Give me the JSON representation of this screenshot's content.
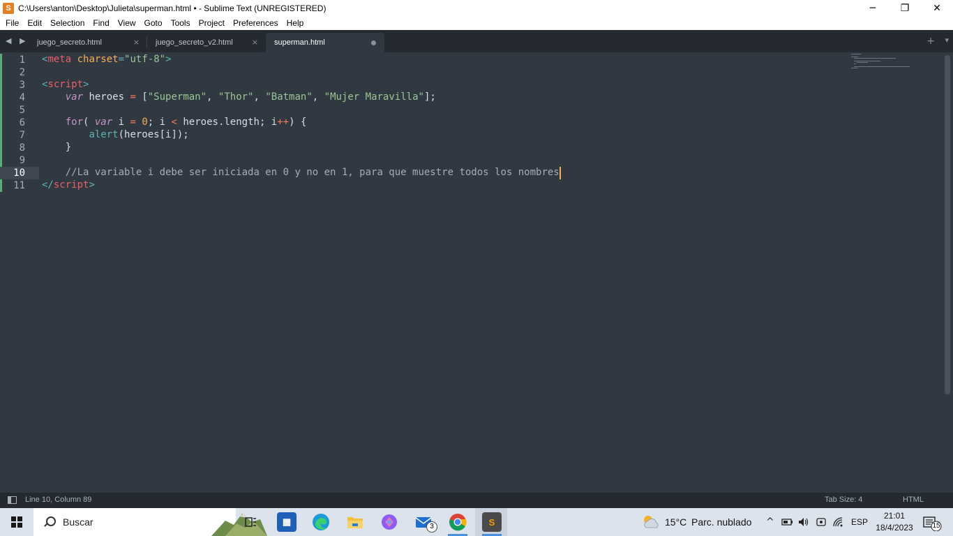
{
  "window": {
    "title": "C:\\Users\\anton\\Desktop\\Julieta\\superman.html • - Sublime Text (UNREGISTERED)",
    "minimize": "─",
    "maximize": "❐",
    "close": "✕"
  },
  "menu": [
    "File",
    "Edit",
    "Selection",
    "Find",
    "View",
    "Goto",
    "Tools",
    "Project",
    "Preferences",
    "Help"
  ],
  "tabs": [
    {
      "label": "juego_secreto.html",
      "active": false,
      "close": "×"
    },
    {
      "label": "juego_secreto_v2.html",
      "active": false,
      "close": "×"
    },
    {
      "label": "superman.html",
      "active": true,
      "modified": true
    }
  ],
  "tabbar": {
    "nav": "◀ ▶",
    "plus": "+",
    "chevron": "▾"
  },
  "editor": {
    "current_line": 10,
    "line_numbers": [
      "1",
      "2",
      "3",
      "4",
      "5",
      "6",
      "7",
      "8",
      "9",
      "10",
      "11"
    ],
    "lines": [
      [
        {
          "t": "<",
          "c": "punc"
        },
        {
          "t": "meta",
          "c": "tag"
        },
        {
          "t": " ",
          "c": ""
        },
        {
          "t": "charset",
          "c": "attr"
        },
        {
          "t": "=",
          "c": "punc"
        },
        {
          "t": "\"utf-8\"",
          "c": "str"
        },
        {
          "t": ">",
          "c": "punc"
        }
      ],
      [],
      [
        {
          "t": "<",
          "c": "punc"
        },
        {
          "t": "script",
          "c": "tag"
        },
        {
          "t": ">",
          "c": "punc"
        }
      ],
      [
        {
          "t": "    ",
          "c": ""
        },
        {
          "t": "var",
          "c": "kw-it"
        },
        {
          "t": " heroes ",
          "c": ""
        },
        {
          "t": "=",
          "c": "op"
        },
        {
          "t": " [",
          "c": ""
        },
        {
          "t": "\"Superman\"",
          "c": "str"
        },
        {
          "t": ", ",
          "c": ""
        },
        {
          "t": "\"Thor\"",
          "c": "str"
        },
        {
          "t": ", ",
          "c": ""
        },
        {
          "t": "\"Batman\"",
          "c": "str"
        },
        {
          "t": ", ",
          "c": ""
        },
        {
          "t": "\"Mujer Maravilla\"",
          "c": "str"
        },
        {
          "t": "];",
          "c": ""
        }
      ],
      [],
      [
        {
          "t": "    ",
          "c": ""
        },
        {
          "t": "for",
          "c": "kw"
        },
        {
          "t": "( ",
          "c": ""
        },
        {
          "t": "var",
          "c": "kw-it"
        },
        {
          "t": " i ",
          "c": ""
        },
        {
          "t": "=",
          "c": "op"
        },
        {
          "t": " ",
          "c": ""
        },
        {
          "t": "0",
          "c": "num"
        },
        {
          "t": "; i ",
          "c": ""
        },
        {
          "t": "<",
          "c": "op"
        },
        {
          "t": " heroes.length; i",
          "c": ""
        },
        {
          "t": "++",
          "c": "op"
        },
        {
          "t": ") {",
          "c": ""
        }
      ],
      [
        {
          "t": "        ",
          "c": ""
        },
        {
          "t": "alert",
          "c": "fn"
        },
        {
          "t": "(heroes[i]);",
          "c": ""
        }
      ],
      [
        {
          "t": "    }",
          "c": ""
        }
      ],
      [],
      [
        {
          "t": "    ",
          "c": ""
        },
        {
          "t": "//La variable i debe ser iniciada en 0 y no en 1, para que muestre todos los nombres",
          "c": "cmt"
        }
      ],
      [
        {
          "t": "</",
          "c": "punc"
        },
        {
          "t": "script",
          "c": "tag"
        },
        {
          "t": ">",
          "c": "punc"
        }
      ]
    ]
  },
  "status": {
    "position": "Line 10, Column 89",
    "tab_size": "Tab Size: 4",
    "syntax": "HTML"
  },
  "taskbar": {
    "search_placeholder": "Buscar",
    "mail_badge": "3",
    "weather_temp": "15°C",
    "weather_desc": "Parc. nublado",
    "language": "ESP",
    "time": "21:01",
    "date": "18/4/2023",
    "notifications": "15",
    "tray_up": "^"
  },
  "colors": {
    "editor_bg": "#303841",
    "tabbar_bg": "#252a30",
    "caret": "#f9ae58",
    "gutter_mark": "#5fa877"
  }
}
